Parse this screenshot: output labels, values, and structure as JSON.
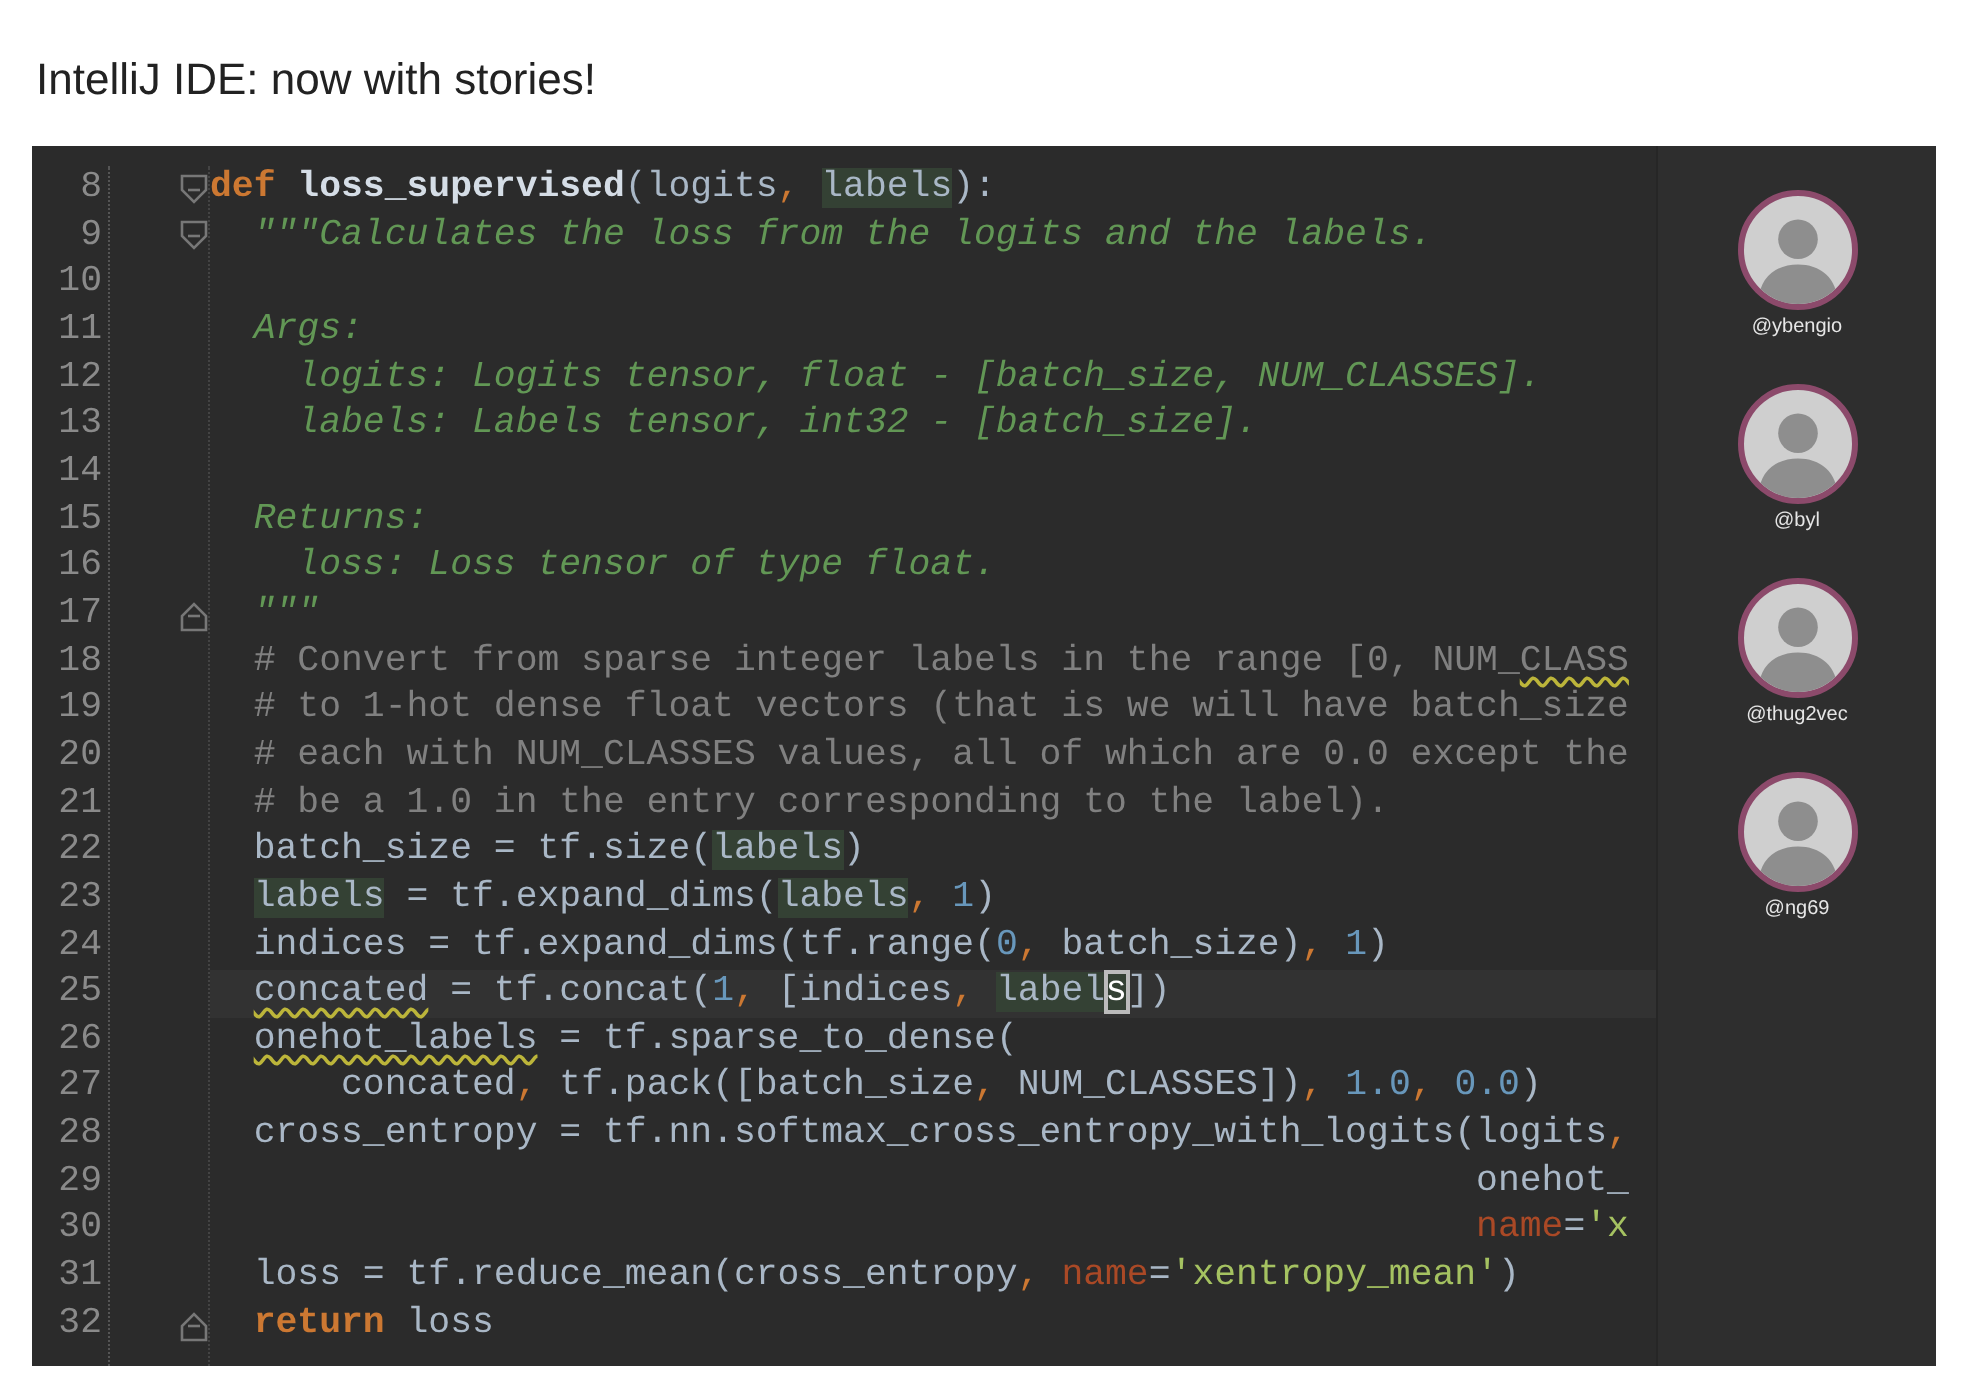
{
  "page_title": "IntelliJ IDE: now with stories!",
  "editor": {
    "lines": [
      {
        "number": "8",
        "fold_start": true,
        "fold_end": false,
        "current": false,
        "tokens": [
          {
            "text": "def",
            "kind": "keyword"
          },
          {
            "text": " loss_supervised",
            "kind": "defname"
          },
          {
            "text": "(logits",
            "kind": "plain"
          },
          {
            "text": ", ",
            "kind": "comma"
          },
          {
            "text": "labels",
            "kind": "match"
          },
          {
            "text": "):",
            "kind": "plain"
          }
        ]
      },
      {
        "number": "9",
        "fold_start": true,
        "fold_end": false,
        "current": false,
        "tokens": [
          {
            "text": "  \"\"\"Calculates the loss from the logits and the labels.",
            "kind": "doc"
          }
        ]
      },
      {
        "number": "10",
        "fold_start": false,
        "fold_end": false,
        "current": false
      },
      {
        "number": "11",
        "fold_start": false,
        "fold_end": false,
        "current": false,
        "tokens": [
          {
            "text": "  Args:",
            "kind": "doc"
          }
        ]
      },
      {
        "number": "12",
        "fold_start": false,
        "fold_end": false,
        "current": false,
        "tokens": [
          {
            "text": "    logits: Logits tensor, float - [batch_size, NUM_CLASSES].",
            "kind": "doc"
          }
        ]
      },
      {
        "number": "13",
        "fold_start": false,
        "fold_end": false,
        "current": false,
        "tokens": [
          {
            "text": "    labels: Labels tensor, int32 - [batch_size].",
            "kind": "doc"
          }
        ]
      },
      {
        "number": "14",
        "fold_start": false,
        "fold_end": false,
        "current": false
      },
      {
        "number": "15",
        "fold_start": false,
        "fold_end": false,
        "current": false,
        "tokens": [
          {
            "text": "  Returns:",
            "kind": "doc"
          }
        ]
      },
      {
        "number": "16",
        "fold_start": false,
        "fold_end": false,
        "current": false,
        "tokens": [
          {
            "text": "    loss: Loss tensor of type float.",
            "kind": "doc"
          }
        ]
      },
      {
        "number": "17",
        "fold_start": false,
        "fold_end": true,
        "current": false,
        "tokens": [
          {
            "text": "  \"\"\"",
            "kind": "doc"
          }
        ]
      },
      {
        "number": "18",
        "fold_start": false,
        "fold_end": false,
        "current": false,
        "tokens": [
          {
            "text": "  # Convert from sparse integer labels in the range [0, NUM_",
            "kind": "comment"
          },
          {
            "text": "CLASS",
            "kind": "comment",
            "squiggle": true
          }
        ]
      },
      {
        "number": "19",
        "fold_start": false,
        "fold_end": false,
        "current": false,
        "tokens": [
          {
            "text": "  # to 1-hot dense float vectors (that is we will have batch_size",
            "kind": "comment"
          }
        ]
      },
      {
        "number": "20",
        "fold_start": false,
        "fold_end": false,
        "current": false,
        "tokens": [
          {
            "text": "  # each with NUM_CLASSES values, all of which are 0.0 except the",
            "kind": "comment"
          }
        ]
      },
      {
        "number": "21",
        "fold_start": false,
        "fold_end": false,
        "current": false,
        "tokens": [
          {
            "text": "  # be a 1.0 in the entry corresponding to the label).",
            "kind": "comment"
          }
        ]
      },
      {
        "number": "22",
        "fold_start": false,
        "fold_end": false,
        "current": false,
        "tokens": [
          {
            "text": "  batch_size = tf.size(",
            "kind": "plain"
          },
          {
            "text": "labels",
            "kind": "match"
          },
          {
            "text": ")",
            "kind": "plain"
          }
        ]
      },
      {
        "number": "23",
        "fold_start": false,
        "fold_end": false,
        "current": false,
        "tokens": [
          {
            "text": "  labels",
            "kind": "match"
          },
          {
            "text": " = tf.expand_dims(",
            "kind": "plain"
          },
          {
            "text": "labels",
            "kind": "match"
          },
          {
            "text": ", ",
            "kind": "comma"
          },
          {
            "text": "1",
            "kind": "number"
          },
          {
            "text": ")",
            "kind": "plain"
          }
        ]
      },
      {
        "number": "24",
        "fold_start": false,
        "fold_end": false,
        "current": false,
        "tokens": [
          {
            "text": "  indices = tf.expand_dims(tf.range(",
            "kind": "plain"
          },
          {
            "text": "0",
            "kind": "number"
          },
          {
            "text": ", ",
            "kind": "comma"
          },
          {
            "text": "batch_size)",
            "kind": "plain"
          },
          {
            "text": ", ",
            "kind": "comma"
          },
          {
            "text": "1",
            "kind": "number"
          },
          {
            "text": ")",
            "kind": "plain"
          }
        ]
      },
      {
        "number": "25",
        "fold_start": false,
        "fold_end": false,
        "current": true,
        "tokens": [
          {
            "text": "  concated",
            "kind": "plain",
            "squiggle": true
          },
          {
            "text": " = tf.concat(",
            "kind": "plain"
          },
          {
            "text": "1",
            "kind": "number"
          },
          {
            "text": ", ",
            "kind": "comma"
          },
          {
            "text": "[indices",
            "kind": "plain"
          },
          {
            "text": ", ",
            "kind": "comma"
          },
          {
            "text": "label",
            "kind": "match"
          },
          {
            "text": "s",
            "kind": "caret"
          },
          {
            "text": "])",
            "kind": "plain"
          }
        ]
      },
      {
        "number": "26",
        "fold_start": false,
        "fold_end": false,
        "current": false,
        "tokens": [
          {
            "text": "  onehot_labels",
            "kind": "plain",
            "squiggle": true
          },
          {
            "text": " = tf.sparse_to_dense(",
            "kind": "plain"
          }
        ]
      },
      {
        "number": "27",
        "fold_start": false,
        "fold_end": false,
        "current": false,
        "tokens": [
          {
            "text": "      concated",
            "kind": "plain"
          },
          {
            "text": ", ",
            "kind": "comma"
          },
          {
            "text": "tf.pack([batch_size",
            "kind": "plain"
          },
          {
            "text": ", ",
            "kind": "comma"
          },
          {
            "text": "NUM_CLASSES])",
            "kind": "plain"
          },
          {
            "text": ", ",
            "kind": "comma"
          },
          {
            "text": "1.0",
            "kind": "number"
          },
          {
            "text": ", ",
            "kind": "comma"
          },
          {
            "text": "0.0",
            "kind": "number"
          },
          {
            "text": ")",
            "kind": "plain"
          }
        ]
      },
      {
        "number": "28",
        "fold_start": false,
        "fold_end": false,
        "current": false,
        "tokens": [
          {
            "text": "  cross_entropy = tf.nn.softmax_cross_entropy_with_logits(logits",
            "kind": "plain"
          },
          {
            "text": ",",
            "kind": "comma"
          }
        ]
      },
      {
        "number": "29",
        "fold_start": false,
        "fold_end": false,
        "current": false,
        "tokens": [
          {
            "text": "                                                          onehot_",
            "kind": "plain"
          }
        ]
      },
      {
        "number": "30",
        "fold_start": false,
        "fold_end": false,
        "current": false,
        "tokens": [
          {
            "text": "                                                          name",
            "kind": "kwarg"
          },
          {
            "text": "=",
            "kind": "plain"
          },
          {
            "text": "'x",
            "kind": "string"
          }
        ]
      },
      {
        "number": "31",
        "fold_start": false,
        "fold_end": false,
        "current": false,
        "tokens": [
          {
            "text": "  loss = tf.reduce_mean(cross_entropy",
            "kind": "plain"
          },
          {
            "text": ", ",
            "kind": "comma"
          },
          {
            "text": "name",
            "kind": "kwarg"
          },
          {
            "text": "=",
            "kind": "plain"
          },
          {
            "text": "'xentropy_mean'",
            "kind": "string"
          },
          {
            "text": ")",
            "kind": "plain"
          }
        ]
      },
      {
        "number": "32",
        "fold_start": false,
        "fold_end": true,
        "current": false,
        "tokens": [
          {
            "text": "  return",
            "kind": "keyword"
          },
          {
            "text": " loss",
            "kind": "plain"
          }
        ]
      }
    ]
  },
  "story_sidebar": {
    "users": [
      {
        "handle": "@ybengio"
      },
      {
        "handle": "@byl"
      },
      {
        "handle": "@thug2vec"
      },
      {
        "handle": "@ng69"
      }
    ]
  }
}
